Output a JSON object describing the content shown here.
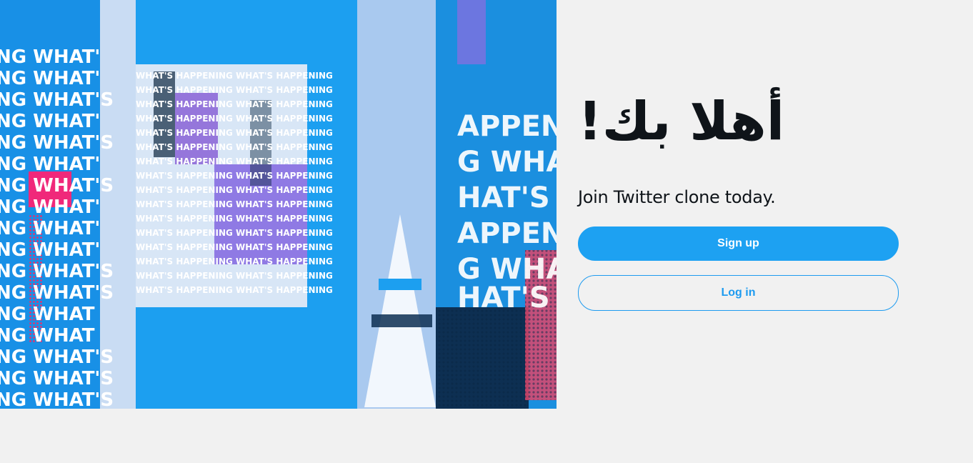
{
  "hero": {
    "image_description_icon": "hero-collage-image",
    "repeated_word": "WHAT'S HAPPENING"
  },
  "welcome": {
    "heading": "أهلا بك!"
  },
  "tagline": "Join Twitter clone today.",
  "buttons": {
    "signup_label": "Sign up",
    "login_label": "Log in"
  },
  "colors": {
    "accent": "#1da1f2",
    "background": "#f1f1f1",
    "text": "#0f1419"
  }
}
